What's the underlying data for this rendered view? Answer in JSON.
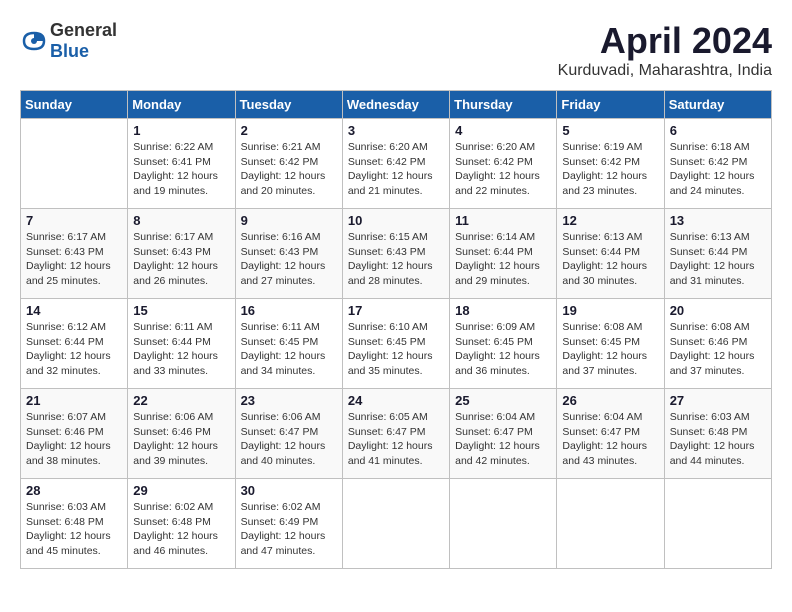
{
  "header": {
    "logo_general": "General",
    "logo_blue": "Blue",
    "month_title": "April 2024",
    "location": "Kurduvadi, Maharashtra, India"
  },
  "days_of_week": [
    "Sunday",
    "Monday",
    "Tuesday",
    "Wednesday",
    "Thursday",
    "Friday",
    "Saturday"
  ],
  "weeks": [
    [
      {
        "day": "",
        "info": ""
      },
      {
        "day": "1",
        "info": "Sunrise: 6:22 AM\nSunset: 6:41 PM\nDaylight: 12 hours\nand 19 minutes."
      },
      {
        "day": "2",
        "info": "Sunrise: 6:21 AM\nSunset: 6:42 PM\nDaylight: 12 hours\nand 20 minutes."
      },
      {
        "day": "3",
        "info": "Sunrise: 6:20 AM\nSunset: 6:42 PM\nDaylight: 12 hours\nand 21 minutes."
      },
      {
        "day": "4",
        "info": "Sunrise: 6:20 AM\nSunset: 6:42 PM\nDaylight: 12 hours\nand 22 minutes."
      },
      {
        "day": "5",
        "info": "Sunrise: 6:19 AM\nSunset: 6:42 PM\nDaylight: 12 hours\nand 23 minutes."
      },
      {
        "day": "6",
        "info": "Sunrise: 6:18 AM\nSunset: 6:42 PM\nDaylight: 12 hours\nand 24 minutes."
      }
    ],
    [
      {
        "day": "7",
        "info": "Sunrise: 6:17 AM\nSunset: 6:43 PM\nDaylight: 12 hours\nand 25 minutes."
      },
      {
        "day": "8",
        "info": "Sunrise: 6:17 AM\nSunset: 6:43 PM\nDaylight: 12 hours\nand 26 minutes."
      },
      {
        "day": "9",
        "info": "Sunrise: 6:16 AM\nSunset: 6:43 PM\nDaylight: 12 hours\nand 27 minutes."
      },
      {
        "day": "10",
        "info": "Sunrise: 6:15 AM\nSunset: 6:43 PM\nDaylight: 12 hours\nand 28 minutes."
      },
      {
        "day": "11",
        "info": "Sunrise: 6:14 AM\nSunset: 6:44 PM\nDaylight: 12 hours\nand 29 minutes."
      },
      {
        "day": "12",
        "info": "Sunrise: 6:13 AM\nSunset: 6:44 PM\nDaylight: 12 hours\nand 30 minutes."
      },
      {
        "day": "13",
        "info": "Sunrise: 6:13 AM\nSunset: 6:44 PM\nDaylight: 12 hours\nand 31 minutes."
      }
    ],
    [
      {
        "day": "14",
        "info": "Sunrise: 6:12 AM\nSunset: 6:44 PM\nDaylight: 12 hours\nand 32 minutes."
      },
      {
        "day": "15",
        "info": "Sunrise: 6:11 AM\nSunset: 6:44 PM\nDaylight: 12 hours\nand 33 minutes."
      },
      {
        "day": "16",
        "info": "Sunrise: 6:11 AM\nSunset: 6:45 PM\nDaylight: 12 hours\nand 34 minutes."
      },
      {
        "day": "17",
        "info": "Sunrise: 6:10 AM\nSunset: 6:45 PM\nDaylight: 12 hours\nand 35 minutes."
      },
      {
        "day": "18",
        "info": "Sunrise: 6:09 AM\nSunset: 6:45 PM\nDaylight: 12 hours\nand 36 minutes."
      },
      {
        "day": "19",
        "info": "Sunrise: 6:08 AM\nSunset: 6:45 PM\nDaylight: 12 hours\nand 37 minutes."
      },
      {
        "day": "20",
        "info": "Sunrise: 6:08 AM\nSunset: 6:46 PM\nDaylight: 12 hours\nand 37 minutes."
      }
    ],
    [
      {
        "day": "21",
        "info": "Sunrise: 6:07 AM\nSunset: 6:46 PM\nDaylight: 12 hours\nand 38 minutes."
      },
      {
        "day": "22",
        "info": "Sunrise: 6:06 AM\nSunset: 6:46 PM\nDaylight: 12 hours\nand 39 minutes."
      },
      {
        "day": "23",
        "info": "Sunrise: 6:06 AM\nSunset: 6:47 PM\nDaylight: 12 hours\nand 40 minutes."
      },
      {
        "day": "24",
        "info": "Sunrise: 6:05 AM\nSunset: 6:47 PM\nDaylight: 12 hours\nand 41 minutes."
      },
      {
        "day": "25",
        "info": "Sunrise: 6:04 AM\nSunset: 6:47 PM\nDaylight: 12 hours\nand 42 minutes."
      },
      {
        "day": "26",
        "info": "Sunrise: 6:04 AM\nSunset: 6:47 PM\nDaylight: 12 hours\nand 43 minutes."
      },
      {
        "day": "27",
        "info": "Sunrise: 6:03 AM\nSunset: 6:48 PM\nDaylight: 12 hours\nand 44 minutes."
      }
    ],
    [
      {
        "day": "28",
        "info": "Sunrise: 6:03 AM\nSunset: 6:48 PM\nDaylight: 12 hours\nand 45 minutes."
      },
      {
        "day": "29",
        "info": "Sunrise: 6:02 AM\nSunset: 6:48 PM\nDaylight: 12 hours\nand 46 minutes."
      },
      {
        "day": "30",
        "info": "Sunrise: 6:02 AM\nSunset: 6:49 PM\nDaylight: 12 hours\nand 47 minutes."
      },
      {
        "day": "",
        "info": ""
      },
      {
        "day": "",
        "info": ""
      },
      {
        "day": "",
        "info": ""
      },
      {
        "day": "",
        "info": ""
      }
    ]
  ]
}
